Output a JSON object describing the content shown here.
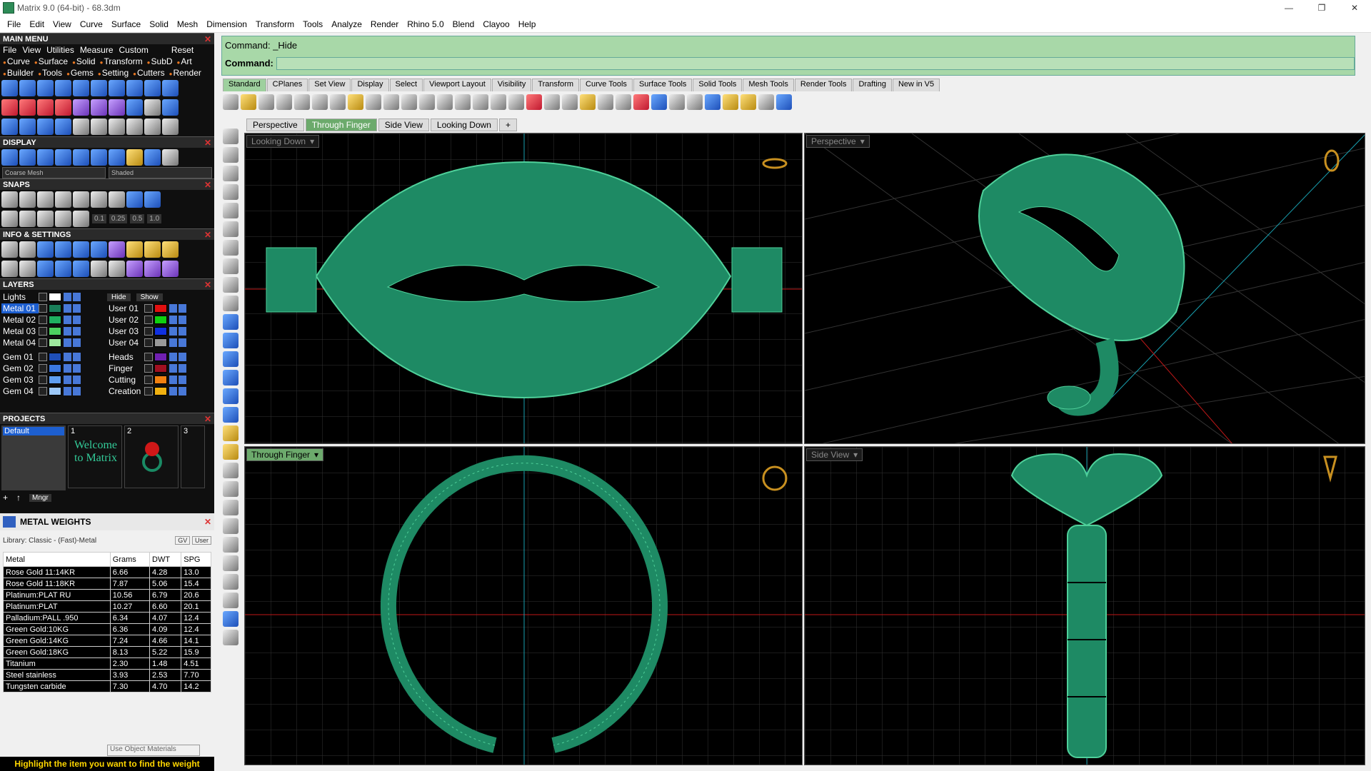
{
  "title": "Matrix 9.0 (64-bit) - 68.3dm",
  "window_controls": [
    "—",
    "❐",
    "✕"
  ],
  "menu": [
    "File",
    "Edit",
    "View",
    "Curve",
    "Surface",
    "Solid",
    "Mesh",
    "Dimension",
    "Transform",
    "Tools",
    "Analyze",
    "Render",
    "Rhino 5.0",
    "Blend",
    "Clayoo",
    "Help"
  ],
  "main_menu": {
    "title": "MAIN MENU",
    "row1": [
      "File",
      "View",
      "Utilities",
      "Measure",
      "Custom",
      "Reset"
    ],
    "row2": [
      "Curve",
      "Surface",
      "Solid",
      "Transform",
      "SubD",
      "Art"
    ],
    "row3": [
      "Builder",
      "Tools",
      "Gems",
      "Setting",
      "Cutters",
      "Render"
    ]
  },
  "display": {
    "title": "DISPLAY",
    "dd1": "Coarse Mesh",
    "dd2": "Shaded"
  },
  "snaps": {
    "title": "SNAPS",
    "vals": [
      "0.1",
      "0.25",
      "0.5",
      "1.0"
    ]
  },
  "info": {
    "title": "INFO & SETTINGS"
  },
  "layers": {
    "title": "LAYERS",
    "hide": "Hide",
    "show": "Show",
    "left": [
      {
        "n": "Lights",
        "c": "#ffffff"
      },
      {
        "n": "Metal 01",
        "c": "#1a7f5a"
      },
      {
        "n": "Metal 02",
        "c": "#1fb060"
      },
      {
        "n": "Metal 03",
        "c": "#4cd060"
      },
      {
        "n": "Metal 04",
        "c": "#9ee89e"
      },
      {
        "n": "Gem 01",
        "c": "#1f4fb8"
      },
      {
        "n": "Gem 02",
        "c": "#3b78e0"
      },
      {
        "n": "Gem 03",
        "c": "#5f9ef0"
      },
      {
        "n": "Gem 04",
        "c": "#9cc8f8"
      }
    ],
    "right": [
      {
        "n": "User 01",
        "c": "#e01010"
      },
      {
        "n": "User 02",
        "c": "#10d010"
      },
      {
        "n": "User 03",
        "c": "#1030e0"
      },
      {
        "n": "User 04",
        "c": "#999999"
      },
      {
        "n": "Heads",
        "c": "#7020b0"
      },
      {
        "n": "Finger",
        "c": "#a01020"
      },
      {
        "n": "Cutting",
        "c": "#f08010"
      },
      {
        "n": "Creation",
        "c": "#f0b010"
      }
    ]
  },
  "projects": {
    "title": "PROJECTS",
    "default": "Default",
    "thumbs": [
      "1",
      "2",
      "3"
    ],
    "welcome": "Welcome to Matrix",
    "mngr": "Mngr"
  },
  "metal_weights": {
    "title": "METAL WEIGHTS",
    "library": "Library: Classic - (Fast)-Metal",
    "gv": "GV",
    "user": "User",
    "headers": [
      "Metal",
      "Grams",
      "DWT",
      "SPG"
    ],
    "rows": [
      [
        "Rose Gold 11:14KR",
        "6.66",
        "4.28",
        "13.0"
      ],
      [
        "Rose Gold 11:18KR",
        "7.87",
        "5.06",
        "15.4"
      ],
      [
        "Platinum:PLAT RU",
        "10.56",
        "6.79",
        "20.6"
      ],
      [
        "Platinum:PLAT",
        "10.27",
        "6.60",
        "20.1"
      ],
      [
        "Palladium:PALL .950",
        "6.34",
        "4.07",
        "12.4"
      ],
      [
        "Green Gold:10KG",
        "6.36",
        "4.09",
        "12.4"
      ],
      [
        "Green Gold:14KG",
        "7.24",
        "4.66",
        "14.1"
      ],
      [
        "Green Gold:18KG",
        "8.13",
        "5.22",
        "15.9"
      ],
      [
        "Titanium",
        "2.30",
        "1.48",
        "4.51"
      ],
      [
        "Steel stainless",
        "3.93",
        "2.53",
        "7.70"
      ],
      [
        "Tungsten carbide",
        "7.30",
        "4.70",
        "14.2"
      ]
    ],
    "use_obj": "Use Object Materials",
    "hint": "Highlight the item you want to find the weight"
  },
  "command": {
    "line1": "Command: _Hide",
    "label": "Command:"
  },
  "tool_tabs": [
    "Standard",
    "CPlanes",
    "Set View",
    "Display",
    "Select",
    "Viewport Layout",
    "Visibility",
    "Transform",
    "Curve Tools",
    "Surface Tools",
    "Solid Tools",
    "Mesh Tools",
    "Render Tools",
    "Drafting",
    "New in V5"
  ],
  "view_tabs": [
    "Perspective",
    "Through Finger",
    "Side View",
    "Looking Down",
    "+"
  ],
  "viewports": {
    "tl": "Looking Down",
    "tr": "Perspective",
    "bl": "Through Finger",
    "br": "Side View"
  },
  "colors": {
    "model": "#1e8a64",
    "wire": "#4fd09a",
    "grid": "#3a3a3a",
    "axis_x": "#c01818",
    "axis_y": "#18a0b0"
  }
}
